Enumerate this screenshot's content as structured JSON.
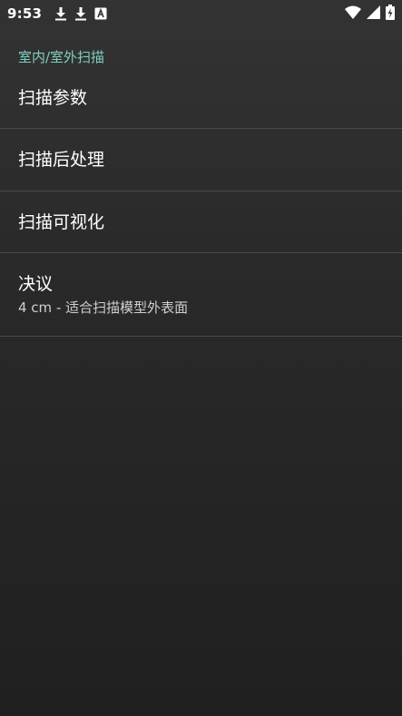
{
  "status_bar": {
    "time": "9:53",
    "left_icons": [
      "download-icon",
      "download-icon",
      "font-icon"
    ],
    "right_icons": [
      "wifi-icon",
      "signal-icon",
      "battery-charging-icon"
    ]
  },
  "settings": {
    "section_header": "室内/室外扫描",
    "items": [
      {
        "title": "扫描参数",
        "summary": ""
      },
      {
        "title": "扫描后处理",
        "summary": ""
      },
      {
        "title": "扫描可视化",
        "summary": ""
      },
      {
        "title": "决议",
        "summary": "4 cm - 适合扫描模型外表面"
      }
    ]
  },
  "colors": {
    "accent": "#7fcfc3",
    "divider": "#4a4a4a",
    "background_top": "#333333",
    "background_bottom": "#202020"
  }
}
